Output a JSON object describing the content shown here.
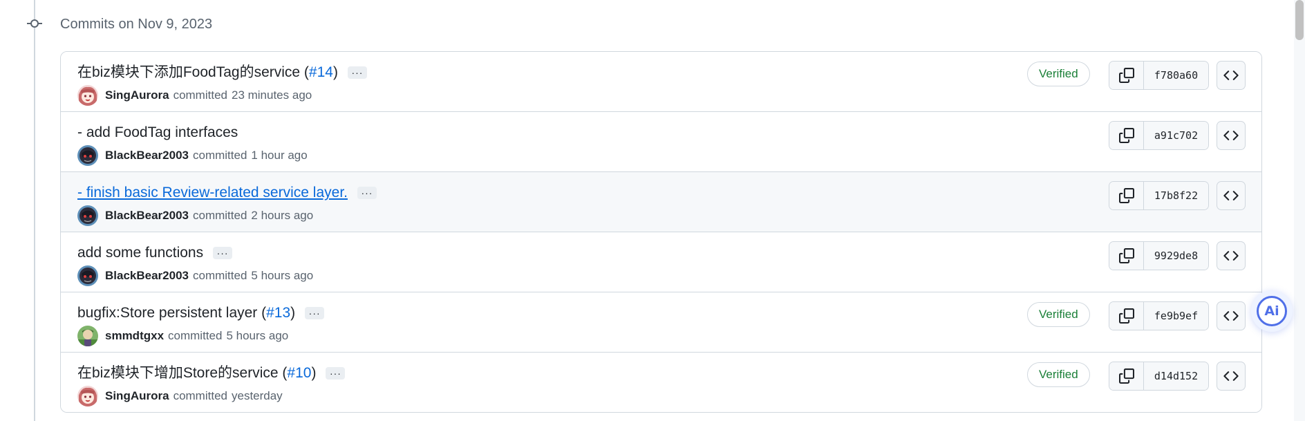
{
  "group": {
    "date_label": "Commits on Nov 9, 2023"
  },
  "commits": [
    {
      "title": "在biz模块下添加FoodTag的service",
      "pr": "#14",
      "has_ellipsis": true,
      "author": "SingAurora",
      "committed_label": "committed",
      "time": "23 minutes ago",
      "verified": "Verified",
      "sha": "f780a60",
      "avatar": "anime-girl"
    },
    {
      "title": "- add FoodTag interfaces",
      "pr": "",
      "has_ellipsis": false,
      "author": "BlackBear2003",
      "committed_label": "committed",
      "time": "1 hour ago",
      "verified": "",
      "sha": "a91c702",
      "avatar": "dark-character"
    },
    {
      "title": "- finish basic Review-related service layer.",
      "pr": "",
      "has_ellipsis": true,
      "author": "BlackBear2003",
      "committed_label": "committed",
      "time": "2 hours ago",
      "verified": "",
      "sha": "17b8f22",
      "avatar": "dark-character",
      "hovered": true
    },
    {
      "title": "add some functions",
      "pr": "",
      "has_ellipsis": true,
      "author": "BlackBear2003",
      "committed_label": "committed",
      "time": "5 hours ago",
      "verified": "",
      "sha": "9929de8",
      "avatar": "dark-character"
    },
    {
      "title": "bugfix:Store persistent layer",
      "pr": "#13",
      "has_ellipsis": true,
      "author": "smmdtgxx",
      "committed_label": "committed",
      "time": "5 hours ago",
      "verified": "Verified",
      "sha": "fe9b9ef",
      "avatar": "green-character"
    },
    {
      "title": "在biz模块下增加Store的service",
      "pr": "#10",
      "has_ellipsis": true,
      "author": "SingAurora",
      "committed_label": "committed",
      "time": "yesterday",
      "verified": "Verified",
      "sha": "d14d152",
      "avatar": "anime-girl"
    }
  ],
  "icons": {
    "commit_node": "git-commit-icon",
    "copy": "copy-icon",
    "browse": "code-icon",
    "ellipsis": "ellipsis-icon"
  },
  "ellipsis_label": "···",
  "ai_button": {
    "label": "Ai"
  },
  "colors": {
    "verified": "#1a7f37",
    "link": "#0969da",
    "border": "#d0d7de",
    "muted": "#59636e",
    "ai_accent": "#4f6fe8"
  }
}
